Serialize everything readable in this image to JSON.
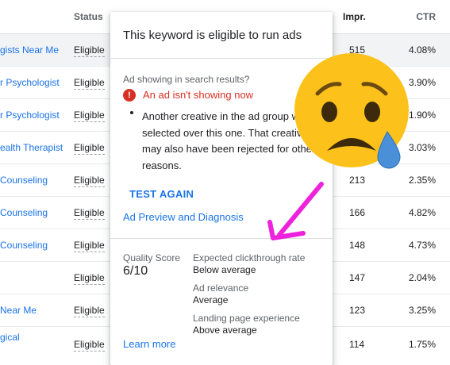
{
  "header": {
    "status_label": "Status",
    "impr_label": "Impr.",
    "ctr_label": "CTR"
  },
  "rows": [
    {
      "keyword": "gists Near Me",
      "status": "Eligible",
      "impr": "515",
      "ctr": "4.08%"
    },
    {
      "keyword": "r Psychologist",
      "status": "Eligible",
      "impr": "",
      "ctr": "3.90%"
    },
    {
      "keyword": "r Psychologist",
      "status": "Eligible",
      "impr": "",
      "ctr": "1.90%"
    },
    {
      "keyword": "ealth Therapist",
      "status": "Eligible",
      "impr": "",
      "ctr": "3.03%"
    },
    {
      "keyword": "Counseling",
      "status": "Eligible",
      "impr": "213",
      "ctr": "2.35%"
    },
    {
      "keyword": "Counseling",
      "status": "Eligible",
      "impr": "166",
      "ctr": "4.82%"
    },
    {
      "keyword": "Counseling",
      "status": "Eligible",
      "impr": "148",
      "ctr": "4.73%"
    },
    {
      "keyword": "",
      "status": "Eligible",
      "impr": "147",
      "ctr": "2.04%"
    },
    {
      "keyword": "Near Me",
      "status": "Eligible",
      "impr": "123",
      "ctr": "3.25%"
    },
    {
      "keyword_line1": "gical",
      "keyword_line2": "",
      "status": "Eligible",
      "impr": "114",
      "ctr": "1.75%"
    }
  ],
  "popup": {
    "title": "This keyword is eligible to run ads",
    "sub_label": "Ad showing in search results?",
    "error_icon": "!",
    "error_text": "An ad isn't showing now",
    "reason": "Another creative in the ad group was selected over this one. That creative may also have been rejected for other reasons.",
    "test_again": "TEST AGAIN",
    "preview_link": "Ad Preview and Diagnosis",
    "quality_score_label": "Quality Score",
    "quality_score_value": "6/10",
    "metrics": [
      {
        "label": "Expected clickthrough rate",
        "value": "Below average"
      },
      {
        "label": "Ad relevance",
        "value": "Average"
      },
      {
        "label": "Landing page experience",
        "value": "Above average"
      }
    ],
    "learn_more": "Learn more"
  },
  "colors": {
    "link": "#1a73e8",
    "error": "#d93025",
    "annotation_arrow": "#ee22dd",
    "emoji_face": "#fcc21b"
  },
  "icons": {
    "error": "exclamation-circle-icon",
    "emoji": "sad-but-relieved-face-emoji",
    "arrow": "hand-drawn-arrow"
  }
}
